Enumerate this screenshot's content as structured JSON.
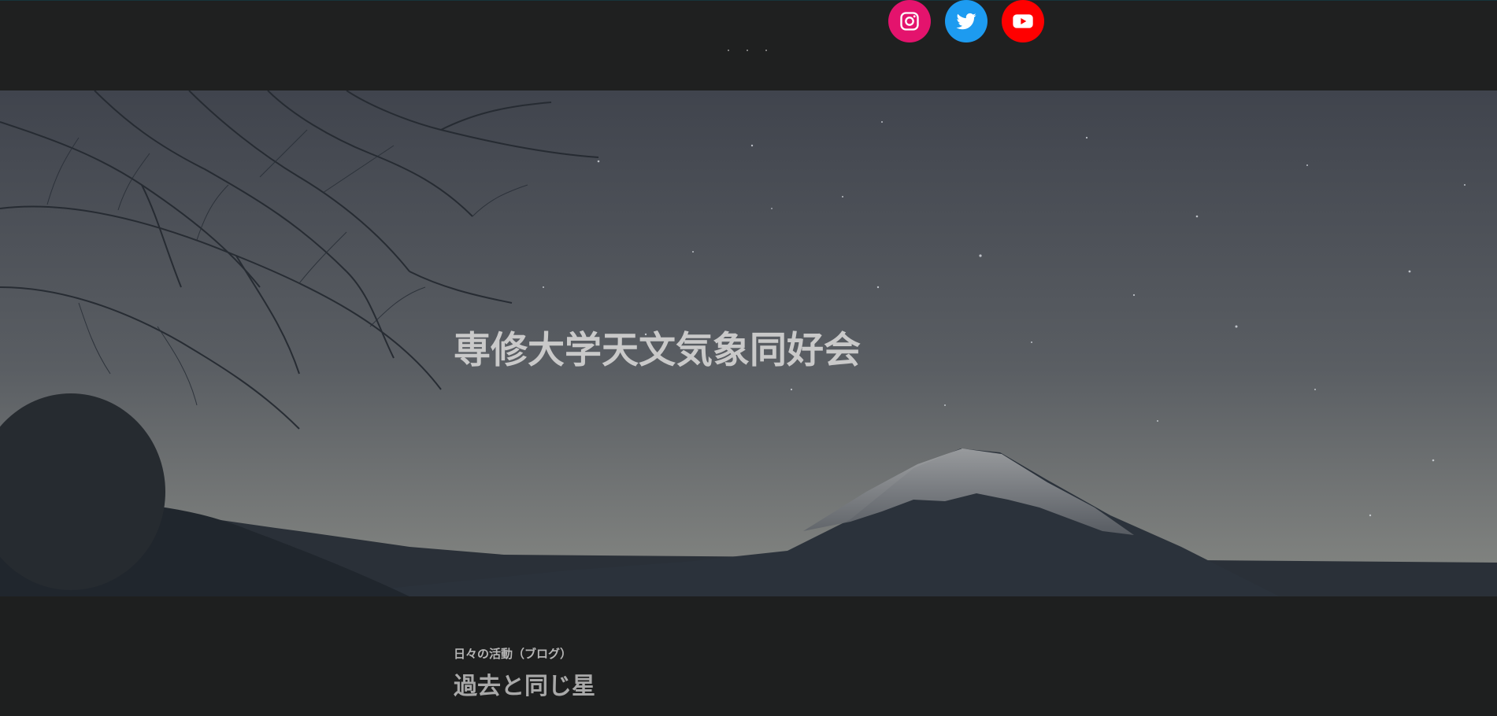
{
  "header": {
    "social": [
      {
        "name": "instagram-icon",
        "color": "#e4136d"
      },
      {
        "name": "twitter-icon",
        "color": "#1d9bf0"
      },
      {
        "name": "youtube-icon",
        "color": "#ff0000"
      }
    ]
  },
  "hero": {
    "title": "専修大学天文気象同好会"
  },
  "post": {
    "category": "日々の活動（ブログ）",
    "title": "過去と同じ星"
  }
}
